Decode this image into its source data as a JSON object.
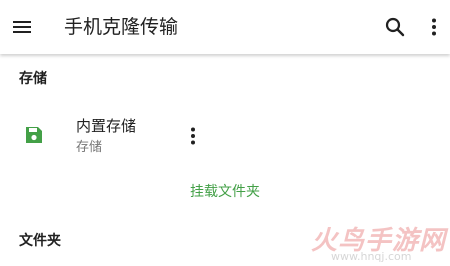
{
  "app_bar": {
    "title": "手机克隆传输",
    "menu_icon": "hamburger-menu-icon",
    "search_icon": "search-icon",
    "more_icon": "more-vert-icon"
  },
  "sections": {
    "storage_header": "存储",
    "folder_header": "文件夹"
  },
  "storage_item": {
    "icon": "save-icon",
    "primary": "内置存储",
    "secondary": "存储",
    "icon_color": "#43a047"
  },
  "mount_link": {
    "label": "挂载文件夹",
    "color": "#43a047"
  },
  "watermark": {
    "text": "火鸟手游网",
    "url": "www.hnqj.com"
  }
}
